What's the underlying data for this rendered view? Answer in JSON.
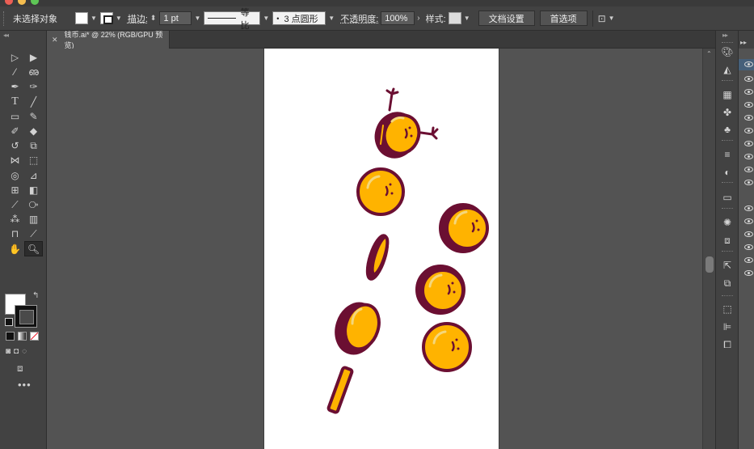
{
  "control_bar": {
    "selection_label": "未选择对象",
    "stroke_label": "描边:",
    "stroke_value": "1 pt",
    "profile_label": "等比",
    "brush_label": "3 点圆形",
    "opacity_label": "不透明度:",
    "opacity_value": "100%",
    "style_label": "样式:",
    "doc_setup_button": "文档设置",
    "preferences_button": "首选项"
  },
  "document": {
    "tab_title": "钱币.ai* @ 22% (RGB/GPU 预览)"
  },
  "artwork": {
    "coin_fill": "#FFB300",
    "coin_outline": "#6B0F32",
    "coin_shine": "#F4D77C"
  },
  "colors": {
    "panel_bg": "#424242",
    "canvas_bg": "#535353",
    "artboard_bg": "#FFFFFF"
  }
}
